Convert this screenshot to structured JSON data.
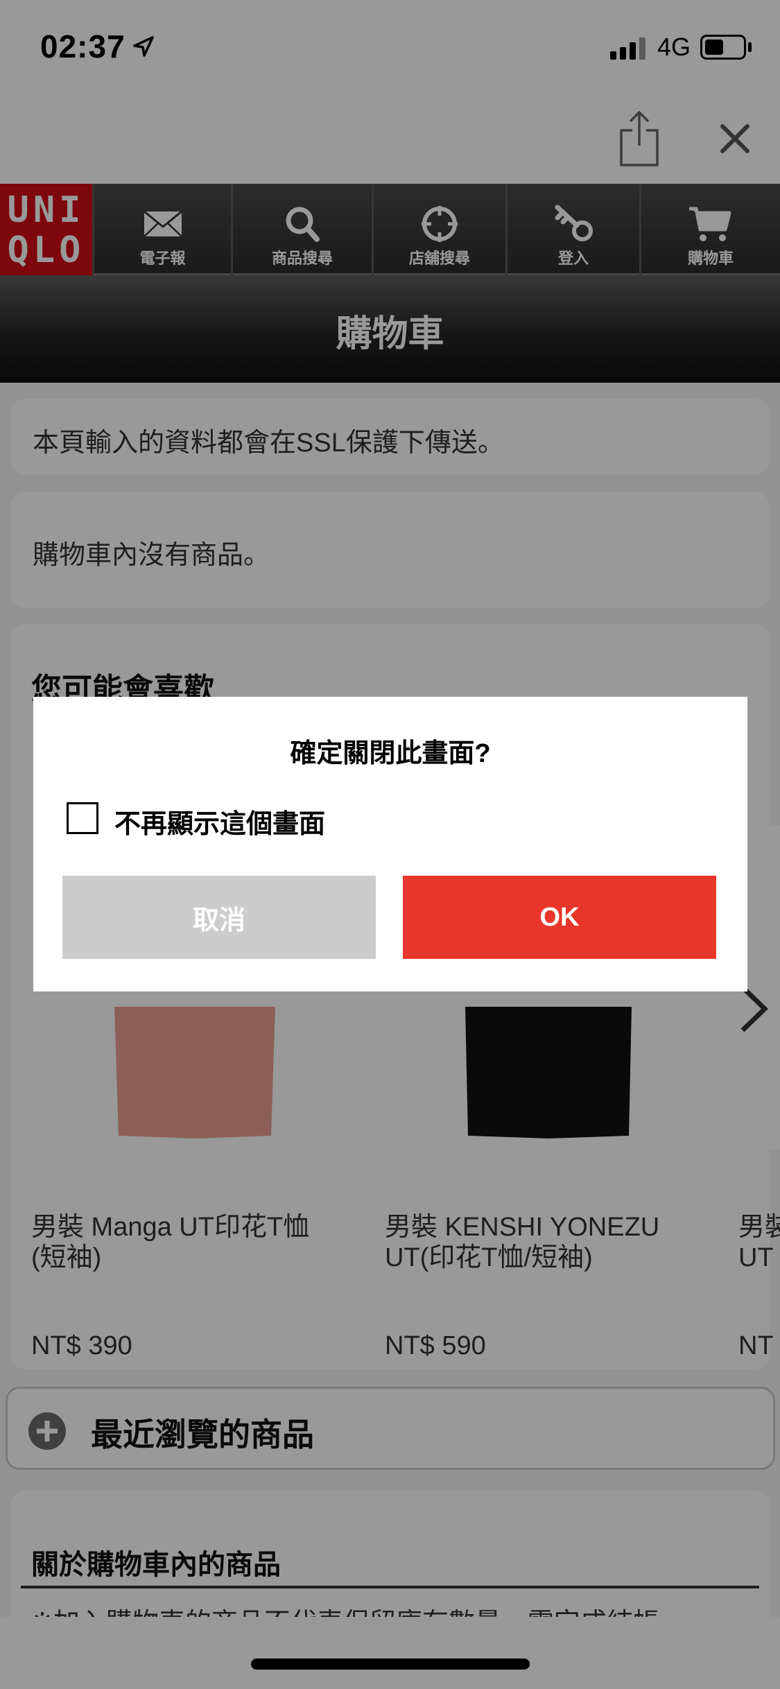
{
  "status_bar": {
    "time": "02:37",
    "location_icon": "location-arrow-icon",
    "network": "4G",
    "battery_level": 0.5
  },
  "browser": {
    "share_icon": "share-icon",
    "close_icon": "close-icon"
  },
  "nav": {
    "logo_line1": "UNI",
    "logo_line2": "QLO",
    "items": [
      {
        "label": "電子報",
        "icon": "envelope-icon"
      },
      {
        "label": "商品搜尋",
        "icon": "search-icon"
      },
      {
        "label": "店舖搜尋",
        "icon": "crosshair-icon"
      },
      {
        "label": "登入",
        "icon": "key-icon"
      },
      {
        "label": "購物車",
        "icon": "cart-icon"
      }
    ]
  },
  "page": {
    "title": "購物車",
    "ssl_notice": "本頁輸入的資料都會在SSL保護下傳送。",
    "empty_cart": "購物車內沒有商品。",
    "recommend_heading": "您可能會喜歡",
    "products": [
      {
        "name_line1": "男裝 Manga UT印花T恤",
        "name_line2": "(短袖)",
        "price": "NT$ 390",
        "color": "#e89f93"
      },
      {
        "name_line1": "男裝 KENSHI YONEZU",
        "name_line2": "UT(印花T恤/短袖)",
        "price": "NT$ 590",
        "color": "#111111"
      },
      {
        "name_line1": "男裝",
        "name_line2": "UT",
        "price": "NT",
        "color": "#ffffff"
      }
    ],
    "recent_label": "最近瀏覽的商品",
    "about_heading": "關於購物車內的商品",
    "about_text": "※加入購物車的商品不代表保留庫存數量，需完成結帳"
  },
  "dialog": {
    "title": "確定關閉此畫面?",
    "checkbox_label": "不再顯示這個畫面",
    "checkbox_checked": false,
    "cancel_label": "取消",
    "ok_label": "OK",
    "ok_color": "#e8362a",
    "cancel_color": "#cccccc"
  }
}
